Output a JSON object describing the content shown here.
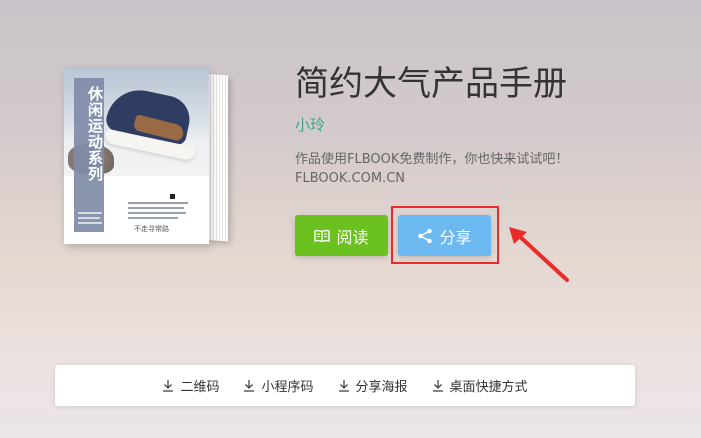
{
  "book": {
    "title": "简约大气产品手册",
    "author": "小玲",
    "description_line1": "作品使用FLBOOK免费制作，你也快来试试吧！",
    "description_line2": "FLBOOK.COM.CN",
    "cover_title": "休闲运动系列",
    "cover_caption": "不走寻常路"
  },
  "actions": {
    "read_label": "阅读",
    "share_label": "分享"
  },
  "bottom_bar": {
    "items": [
      {
        "label": "二维码",
        "icon": "download-icon"
      },
      {
        "label": "小程序码",
        "icon": "download-icon"
      },
      {
        "label": "分享海报",
        "icon": "download-icon"
      },
      {
        "label": "桌面快捷方式",
        "icon": "download-icon"
      }
    ]
  },
  "colors": {
    "read_button": "#6bc11f",
    "share_button": "#6cb8f1",
    "author_link": "#3aa58a",
    "highlight": "#e82b2b"
  }
}
